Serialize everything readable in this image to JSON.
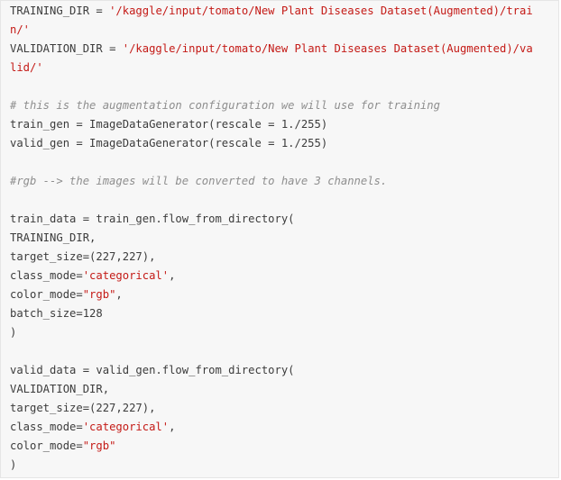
{
  "code_lines": [
    [
      {
        "t": "TRAINING_DIR ",
        "c": "plain"
      },
      {
        "t": "=",
        "c": "op"
      },
      {
        "t": " ",
        "c": "plain"
      },
      {
        "t": "'/kaggle/input/tomato/New Plant Diseases Dataset(Augmented)/trai",
        "c": "str"
      }
    ],
    [
      {
        "t": "n/'",
        "c": "str"
      }
    ],
    [
      {
        "t": "VALIDATION_DIR ",
        "c": "plain"
      },
      {
        "t": "=",
        "c": "op"
      },
      {
        "t": " ",
        "c": "plain"
      },
      {
        "t": "'/kaggle/input/tomato/New Plant Diseases Dataset(Augmented)/va",
        "c": "str"
      }
    ],
    [
      {
        "t": "lid/'",
        "c": "str"
      }
    ],
    [],
    [
      {
        "t": "# this is the augmentation configuration we will use for training",
        "c": "comment"
      }
    ],
    [
      {
        "t": "train_gen = ImageDataGenerator(rescale = 1./255)",
        "c": "plain"
      }
    ],
    [
      {
        "t": "valid_gen = ImageDataGenerator(rescale = 1./255)",
        "c": "plain"
      }
    ],
    [],
    [
      {
        "t": "#rgb --> the images will be converted to have 3 channels.",
        "c": "comment"
      }
    ],
    [],
    [
      {
        "t": "train_data = train_gen.flow_from_directory(",
        "c": "plain"
      }
    ],
    [
      {
        "t": "TRAINING_DIR,",
        "c": "plain"
      }
    ],
    [
      {
        "t": "target_size=(227,227),",
        "c": "plain"
      }
    ],
    [
      {
        "t": "class_mode=",
        "c": "plain"
      },
      {
        "t": "'categorical'",
        "c": "str"
      },
      {
        "t": ",",
        "c": "plain"
      }
    ],
    [
      {
        "t": "color_mode=",
        "c": "plain"
      },
      {
        "t": "\"rgb\"",
        "c": "str"
      },
      {
        "t": ",",
        "c": "plain"
      }
    ],
    [
      {
        "t": "batch_size=128",
        "c": "plain"
      }
    ],
    [
      {
        "t": ")",
        "c": "plain"
      }
    ],
    [],
    [
      {
        "t": "valid_data = valid_gen.flow_from_directory(",
        "c": "plain"
      }
    ],
    [
      {
        "t": "VALIDATION_DIR,",
        "c": "plain"
      }
    ],
    [
      {
        "t": "target_size=(227,227),",
        "c": "plain"
      }
    ],
    [
      {
        "t": "class_mode=",
        "c": "plain"
      },
      {
        "t": "'categorical'",
        "c": "str"
      },
      {
        "t": ",",
        "c": "plain"
      }
    ],
    [
      {
        "t": "color_mode=",
        "c": "plain"
      },
      {
        "t": "\"rgb\"",
        "c": "str"
      }
    ],
    [
      {
        "t": ")",
        "c": "plain"
      }
    ]
  ],
  "colors": {
    "background": "#f7f7f7",
    "text": "#3c3c3c",
    "string": "#c41a16",
    "comment": "#8e8e8e"
  }
}
